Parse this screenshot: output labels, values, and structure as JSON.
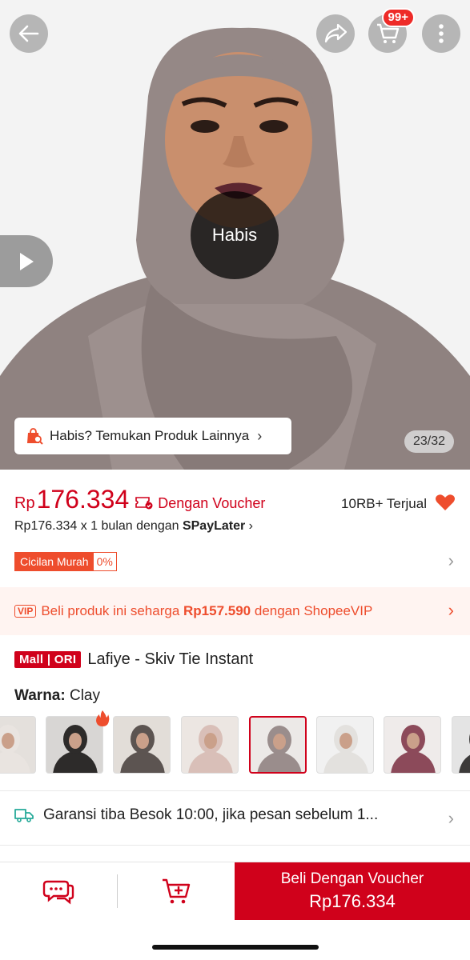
{
  "hero": {
    "sold_out_label": "Habis",
    "similar_label": "Habis? Temukan Produk Lainnya",
    "image_counter": "23/32",
    "cart_badge": "99+"
  },
  "price": {
    "currency": "Rp",
    "value": "176.334",
    "voucher_label": "Dengan Voucher",
    "sold_count": "10RB+ Terjual",
    "paylater_prefix": "Rp176.334 x 1 bulan dengan ",
    "paylater_brand": "SPayLater",
    "installment_label": "Cicilan Murah",
    "installment_rate": "0%"
  },
  "vip": {
    "tag": "VIP",
    "prefix": "Beli produk ini seharga ",
    "price": "Rp157.590",
    "suffix": " dengan ShopeeVIP"
  },
  "product": {
    "mall_tag": "Mall | ORI",
    "title": "Lafiye - Skiv Tie Instant",
    "variant_label": "Warna:",
    "variant_value": "Clay"
  },
  "swatches": [
    {
      "color": "#e4e0dc",
      "hijab": "#e9e4e0"
    },
    {
      "color": "#d8d6d4",
      "hijab": "#2d2b2a"
    },
    {
      "color": "#e2ddd8",
      "hijab": "#5c5451"
    },
    {
      "color": "#ece6e2",
      "hijab": "#d9bfb8"
    },
    {
      "color": "#ece9e7",
      "hijab": "#9a8d8c"
    },
    {
      "color": "#f1f1f1",
      "hijab": "#e3e1de"
    },
    {
      "color": "#efebea",
      "hijab": "#8c4a5a"
    },
    {
      "color": "#e4e4e4",
      "hijab": "#3c3a39"
    }
  ],
  "shipping": {
    "text": "Garansi tiba Besok 10:00, jika pesan sebelum 1..."
  },
  "bottom_bar": {
    "buy_label": "Beli Dengan Voucher",
    "buy_price": "Rp176.334"
  },
  "colors": {
    "brand_red": "#d0011b",
    "shopee_orange": "#ee4d2d"
  }
}
